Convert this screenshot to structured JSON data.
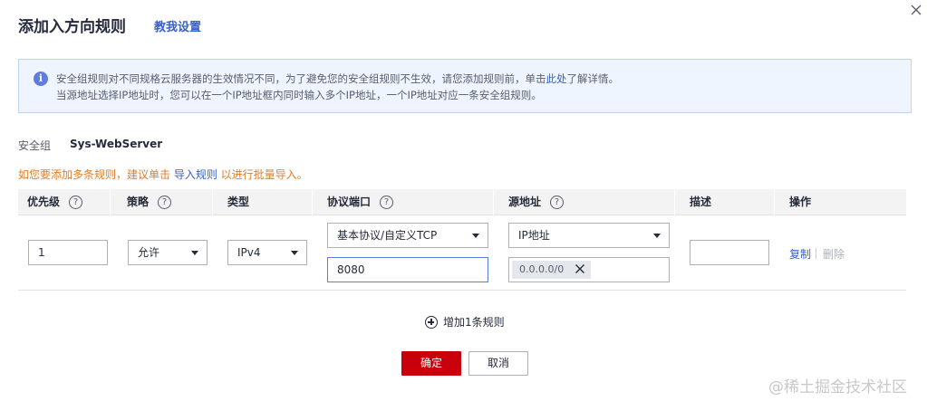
{
  "dialog": {
    "title": "添加入方向规则",
    "tutorial_link": "教我设置"
  },
  "notice": {
    "line1_prefix": "安全组规则对不同规格云服务器的生效情况不同，为了避免您的安全组规则不生效，请您添加规则前，单击",
    "line1_link": "此处",
    "line1_suffix": "了解详情。",
    "line2": "当源地址选择IP地址时，您可以在一个IP地址框内同时输入多个IP地址，一个IP地址对应一条安全组规则。"
  },
  "security_group": {
    "label": "安全组",
    "value": "Sys-WebServer"
  },
  "tip": {
    "prefix": "如您要添加多条规则，建议单击 ",
    "link": "导入规则",
    "suffix": " 以进行批量导入。"
  },
  "table": {
    "headers": {
      "priority": "优先级",
      "policy": "策略",
      "type": "类型",
      "protocol_port": "协议端口",
      "source": "源地址",
      "description": "描述",
      "actions": "操作"
    },
    "help_glyph": "?",
    "row": {
      "priority": "1",
      "policy": "允许",
      "type": "IPv4",
      "protocol": "基本协议/自定义TCP",
      "port": "8080",
      "source_type": "IP地址",
      "source_ip": "0.0.0.0/0",
      "description": "",
      "copy": "复制",
      "delete": "删除"
    }
  },
  "add_rule": "增加1条规则",
  "buttons": {
    "ok": "确定",
    "cancel": "取消"
  },
  "watermark": "@稀土掘金技术社区",
  "colors": {
    "primary_red": "#c7000b",
    "link_blue": "#3860c8",
    "tip_orange": "#e37d29",
    "info_blue": "#5e7ce0",
    "notice_bg": "#eef5fe"
  }
}
